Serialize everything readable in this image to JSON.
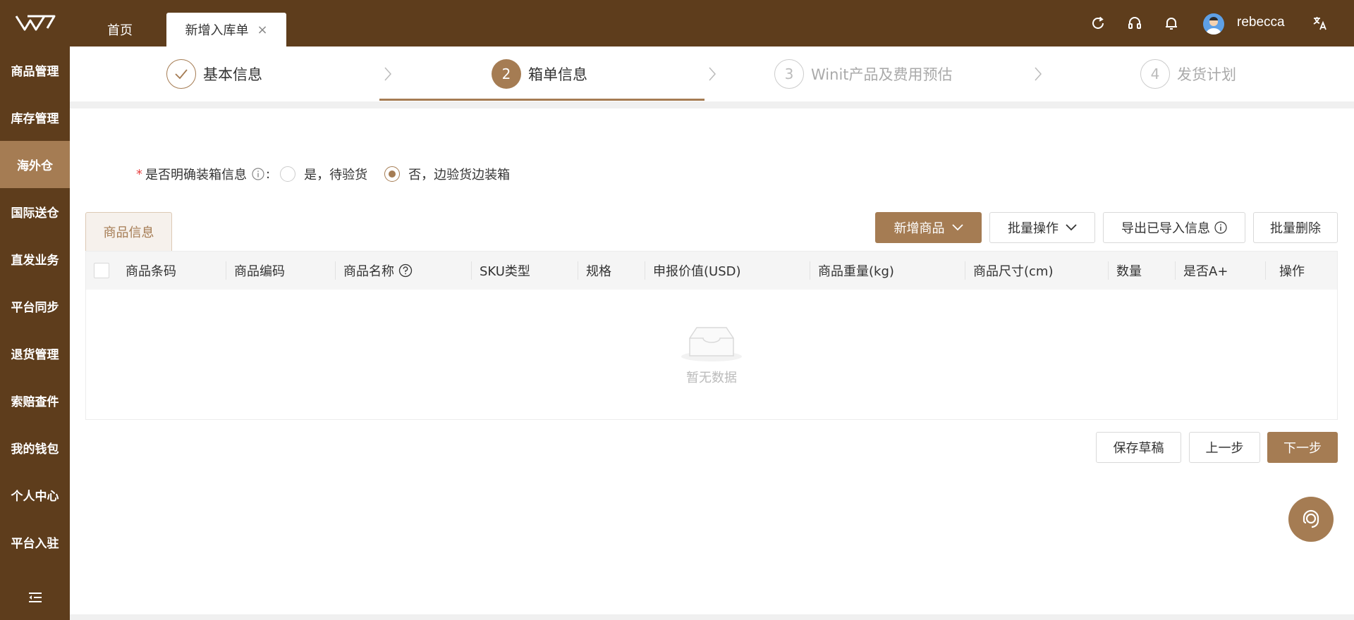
{
  "sidebar": {
    "items": [
      {
        "label": "商品管理"
      },
      {
        "label": "库存管理"
      },
      {
        "label": "海外仓"
      },
      {
        "label": "国际送仓"
      },
      {
        "label": "直发业务"
      },
      {
        "label": "平台同步"
      },
      {
        "label": "退货管理"
      },
      {
        "label": "索赔查件"
      },
      {
        "label": "我的钱包"
      },
      {
        "label": "个人中心"
      },
      {
        "label": "平台入驻"
      }
    ],
    "active_index": 2,
    "collapse_icon": "menu-fold-icon"
  },
  "header": {
    "tabs": [
      {
        "label": "首页"
      },
      {
        "label": "新增入库单"
      }
    ],
    "close_symbol": "×",
    "icons": [
      "refresh-icon",
      "headset-icon",
      "bell-icon",
      "translate-icon"
    ],
    "username": "rebecca"
  },
  "steps": [
    {
      "number": "",
      "title": "基本信息",
      "status": "done"
    },
    {
      "number": "2",
      "title": "箱单信息",
      "status": "active"
    },
    {
      "number": "3",
      "title": "Winit产品及费用预估",
      "status": "wait"
    },
    {
      "number": "4",
      "title": "发货计划",
      "status": "wait"
    }
  ],
  "form": {
    "required_mark": "*",
    "question_label": "是否明确装箱信息",
    "colon": ":",
    "options": [
      {
        "label": "是，待验货",
        "checked": false
      },
      {
        "label": "否，边验货边装箱",
        "checked": true
      }
    ]
  },
  "product_tab": {
    "label": "商品信息"
  },
  "toolbar": {
    "add_product": "新增商品",
    "batch_ops": "批量操作",
    "export_imported": "导出已导入信息",
    "batch_delete": "批量删除"
  },
  "table": {
    "columns": [
      "商品条码",
      "商品编码",
      "商品名称",
      "SKU类型",
      "规格",
      "申报价值(USD)",
      "商品重量(kg)",
      "商品尺寸(cm)",
      "数量",
      "是否A+",
      "操作"
    ],
    "rows": [],
    "empty_text": "暂无数据"
  },
  "footer": {
    "save_draft": "保存草稿",
    "prev": "上一步",
    "next": "下一步"
  },
  "colors": {
    "brand_dark": "#5e3d1c",
    "brand": "#a57c53",
    "active_sidebar": "#a57c53"
  }
}
